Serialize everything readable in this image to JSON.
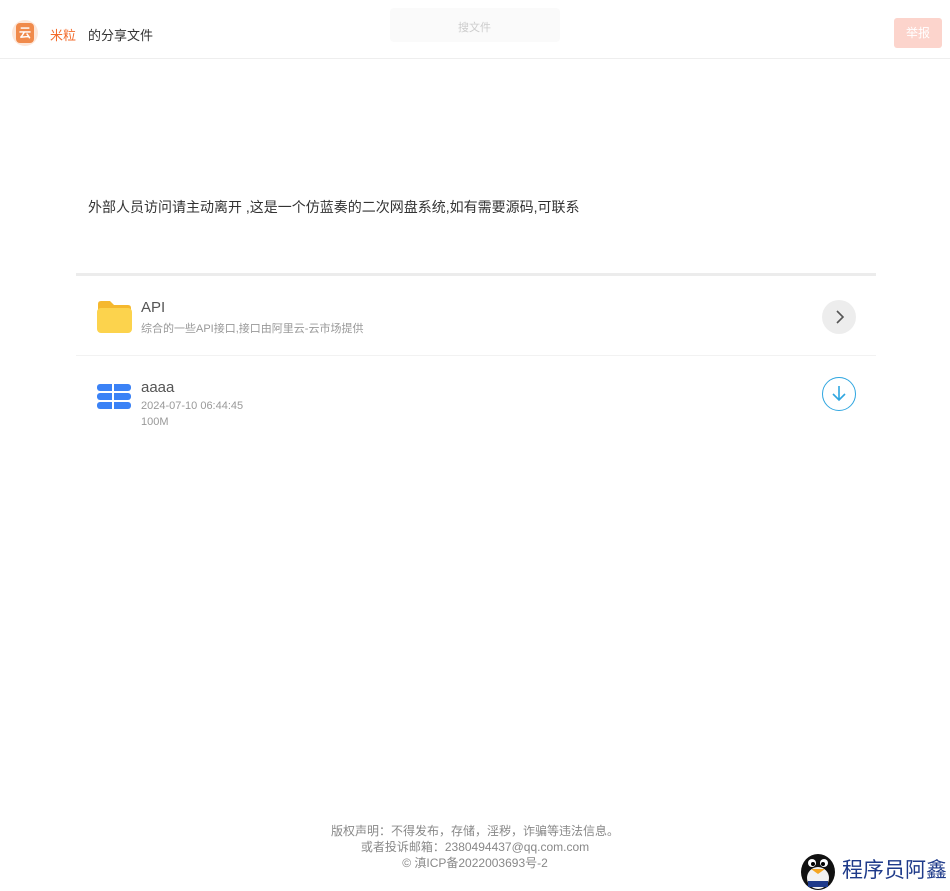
{
  "header": {
    "logo_char": "云",
    "owner": "米粒",
    "share_text": "的分享文件",
    "search_placeholder": "搜文件",
    "report_label": "举报"
  },
  "description": "外部人员访问请主动离开 ,这是一个仿蓝奏的二次网盘系统,如有需要源码,可联系",
  "items": [
    {
      "type": "folder",
      "name": "API",
      "desc": "综合的一些API接口,接口由阿里云-云市场提供",
      "icon": "folder-icon",
      "action_icon": "chevron-right-icon"
    },
    {
      "type": "file",
      "name": "aaaa",
      "date": "2024-07-10 06:44:45",
      "size": "100M",
      "icon": "file-stack-icon",
      "action_icon": "download-icon"
    }
  ],
  "footer": {
    "line1": "版权声明：不得发布，存储，淫秽，诈骗等违法信息。",
    "line2": "或者投诉邮箱：2380494437@qq.com.com",
    "line3": "© 滇ICP备2022003693号-2"
  },
  "watermark": {
    "text": "程序员阿鑫"
  },
  "colors": {
    "accent": "#f36b2b",
    "report_bg": "#fcd4cc",
    "folder": "#fcd34d",
    "file_blue": "#3b82f6",
    "download_ring": "#2fa6e0"
  }
}
